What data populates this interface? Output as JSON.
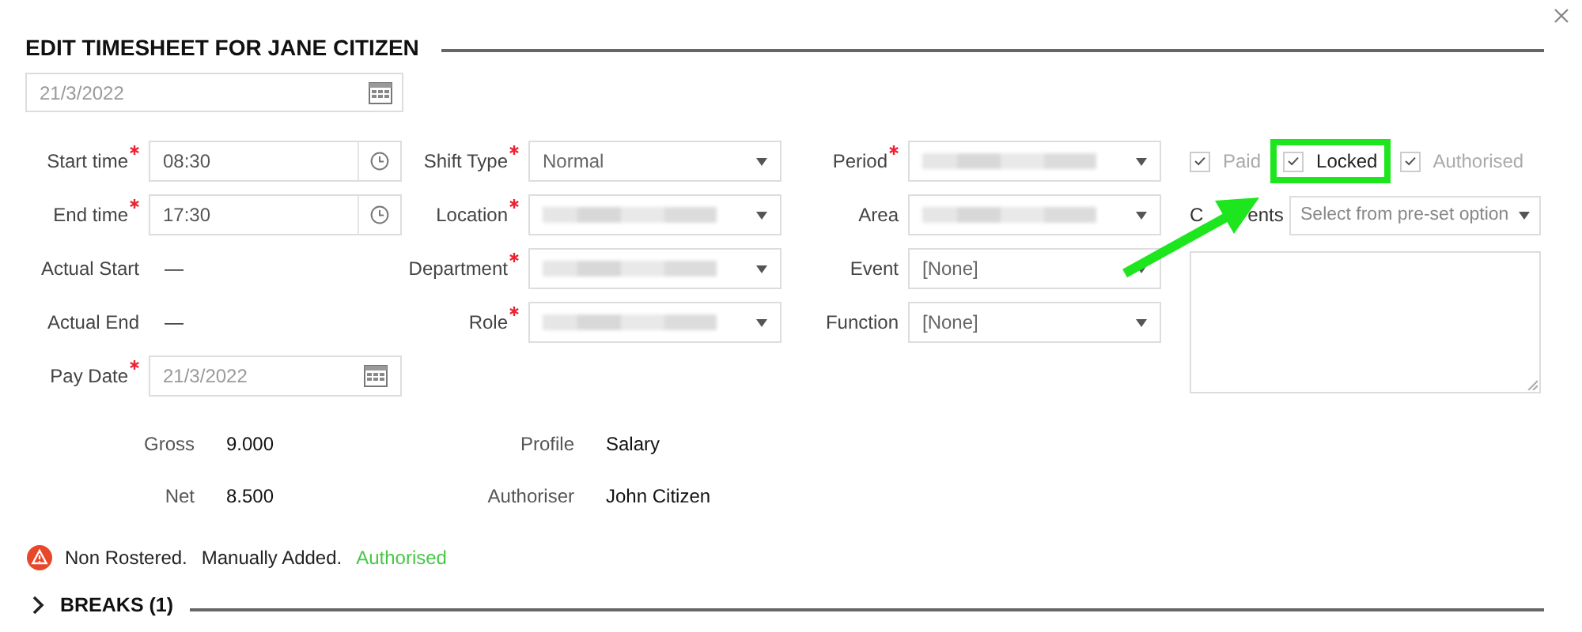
{
  "dialog": {
    "title": "EDIT TIMESHEET FOR JANE CITIZEN"
  },
  "date_field": {
    "value": "21/3/2022"
  },
  "columns": [
    [
      {
        "label": "Start time",
        "required": true,
        "kind": "time",
        "value": "08:30"
      },
      {
        "label": "End time",
        "required": true,
        "kind": "time",
        "value": "17:30"
      },
      {
        "label": "Actual Start",
        "required": false,
        "kind": "readonly",
        "value": "—"
      },
      {
        "label": "Actual End",
        "required": false,
        "kind": "readonly",
        "value": "—"
      },
      {
        "label": "Pay Date",
        "required": true,
        "kind": "date",
        "value": "21/3/2022"
      }
    ],
    [
      {
        "label": "Shift Type",
        "required": true,
        "kind": "select",
        "value": "Normal"
      },
      {
        "label": "Location",
        "required": true,
        "kind": "redacted-select"
      },
      {
        "label": "Department",
        "required": true,
        "kind": "redacted-select"
      },
      {
        "label": "Role",
        "required": true,
        "kind": "redacted-select"
      }
    ],
    [
      {
        "label": "Period",
        "required": true,
        "kind": "redacted-select"
      },
      {
        "label": "Area",
        "required": false,
        "kind": "redacted-select"
      },
      {
        "label": "Event",
        "required": false,
        "kind": "select",
        "value": "[None]"
      },
      {
        "label": "Function",
        "required": false,
        "kind": "select",
        "value": "[None]"
      }
    ]
  ],
  "flags": [
    {
      "label": "Paid",
      "checked": true,
      "disabled": true,
      "highlighted": false
    },
    {
      "label": "Locked",
      "checked": true,
      "disabled": false,
      "highlighted": true
    },
    {
      "label": "Authorised",
      "checked": true,
      "disabled": true,
      "highlighted": false
    }
  ],
  "comments": {
    "label_parts": [
      "C",
      "ents"
    ],
    "preset_placeholder": "Select from pre-set option"
  },
  "summary": [
    {
      "label": "Gross",
      "value": "9.000"
    },
    {
      "label": "Profile",
      "value": "Salary"
    },
    {
      "label": "Net",
      "value": "8.500"
    },
    {
      "label": "Authoriser",
      "value": "John Citizen"
    }
  ],
  "status": {
    "items": [
      {
        "text": "Non Rostered.",
        "kind": "normal"
      },
      {
        "text": "Manually Added.",
        "kind": "normal"
      },
      {
        "text": "Authorised",
        "kind": "success"
      }
    ]
  },
  "breaks": {
    "title": "BREAKS (1)",
    "expanded": false
  }
}
